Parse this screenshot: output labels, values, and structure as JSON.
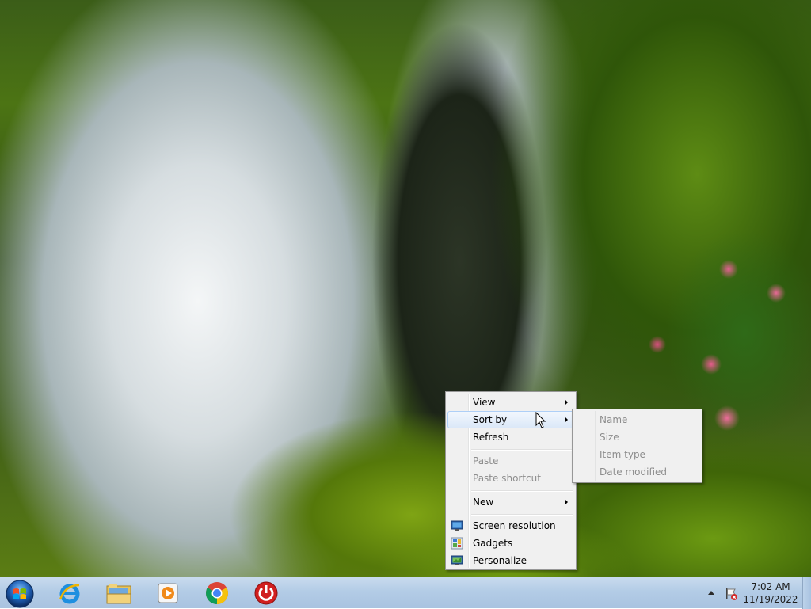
{
  "context_menu": {
    "items": [
      {
        "label": "View",
        "submenu": true,
        "enabled": true
      },
      {
        "label": "Sort by",
        "submenu": true,
        "enabled": true,
        "highlighted": true
      },
      {
        "label": "Refresh",
        "enabled": true
      },
      {
        "label": "Paste",
        "enabled": false
      },
      {
        "label": "Paste shortcut",
        "enabled": false
      },
      {
        "label": "New",
        "submenu": true,
        "enabled": true
      },
      {
        "label": "Screen resolution",
        "icon": "screen-resolution-icon",
        "enabled": true
      },
      {
        "label": "Gadgets",
        "icon": "gadgets-icon",
        "enabled": true
      },
      {
        "label": "Personalize",
        "icon": "personalize-icon",
        "enabled": true
      }
    ]
  },
  "sort_submenu": {
    "items": [
      {
        "label": "Name",
        "enabled": false
      },
      {
        "label": "Size",
        "enabled": false
      },
      {
        "label": "Item type",
        "enabled": false
      },
      {
        "label": "Date modified",
        "enabled": false
      }
    ]
  },
  "taskbar": {
    "start_icon": "windows-start-orb-icon",
    "pinned": [
      {
        "name": "internet-explorer-icon"
      },
      {
        "name": "file-explorer-icon"
      },
      {
        "name": "media-player-icon"
      },
      {
        "name": "chrome-icon"
      },
      {
        "name": "power-app-icon"
      }
    ],
    "tray": {
      "time": "7:02 AM",
      "date": "11/19/2022"
    }
  },
  "colors": {
    "menu_bg": "#f0f0f0",
    "menu_highlight": "#dbe8f8",
    "disabled_text": "#8d8d8d",
    "taskbar": "#b3cce6"
  }
}
